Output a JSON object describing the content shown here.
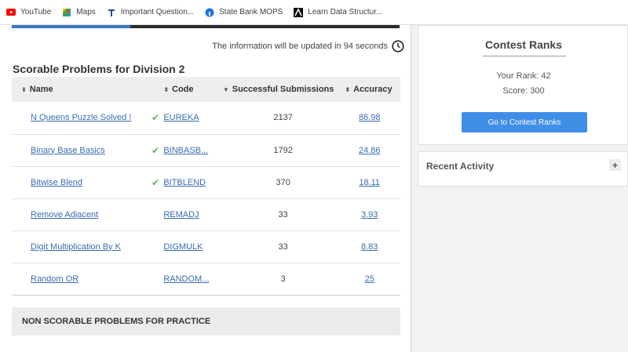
{
  "bookmarks": [
    {
      "label": "YouTube",
      "icon": "youtube-icon"
    },
    {
      "label": "Maps",
      "icon": "maps-icon"
    },
    {
      "label": "Important Question...",
      "icon": "bookmark-t-icon"
    },
    {
      "label": "State Bank MOPS",
      "icon": "globe-icon"
    },
    {
      "label": "Learn Data Structur...",
      "icon": "site-logo-icon"
    }
  ],
  "update_notice": "The information will be updated in 94 seconds",
  "scorable": {
    "title": "Scorable Problems for Division 2",
    "headers": {
      "name": "Name",
      "code": "Code",
      "submissions": "Successful Submissions",
      "accuracy": "Accuracy"
    },
    "rows": [
      {
        "name": "N Queens Puzzle Solved !",
        "solved": true,
        "code": "EUREKA",
        "submissions": "2137",
        "accuracy": "86.98"
      },
      {
        "name": "Binary Base Basics",
        "solved": true,
        "code": "BINBASB...",
        "submissions": "1792",
        "accuracy": "24.86"
      },
      {
        "name": "Bitwise Blend",
        "solved": true,
        "code": "BITBLEND",
        "submissions": "370",
        "accuracy": "18.11"
      },
      {
        "name": "Remove Adjacent",
        "solved": false,
        "code": "REMADJ",
        "submissions": "33",
        "accuracy": "3.93"
      },
      {
        "name": "Digit Multiplication By K",
        "solved": false,
        "code": "DIGMULK",
        "submissions": "33",
        "accuracy": "8.83"
      },
      {
        "name": "Random OR",
        "solved": false,
        "code": "RANDOM...",
        "submissions": "3",
        "accuracy": "25"
      }
    ]
  },
  "non_scorable_title": "NON SCORABLE PROBLEMS FOR PRACTICE",
  "contest_ranks": {
    "title": "Contest Ranks",
    "rank_text": "Your Rank: 42",
    "score_text": "Score: 300",
    "button_label": "Go to Contest Ranks"
  },
  "recent_activity": {
    "title": "Recent Activity",
    "expand_label": "+"
  },
  "colors": {
    "link": "#3a6db3",
    "check": "#63b363",
    "button": "#3f8fe8"
  }
}
